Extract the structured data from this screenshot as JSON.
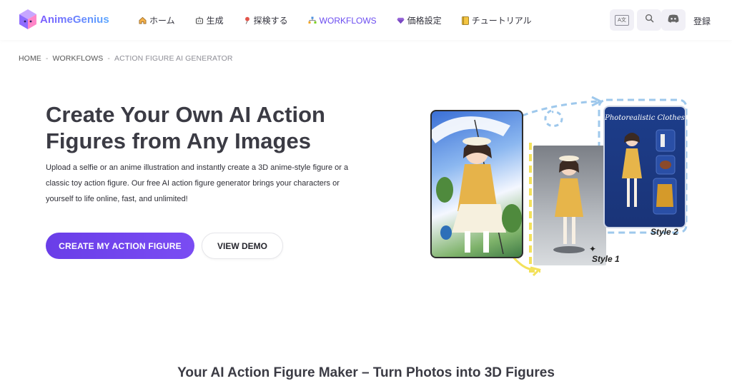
{
  "header": {
    "logo_text": "AnimeGenius",
    "nav": [
      {
        "label": "ホーム",
        "icon": "home-icon"
      },
      {
        "label": "生成",
        "icon": "robot-icon"
      },
      {
        "label": "探検する",
        "icon": "pin-icon"
      },
      {
        "label": "WORKFLOWS",
        "icon": "workflow-icon"
      },
      {
        "label": "価格設定",
        "icon": "gem-icon"
      },
      {
        "label": "チュートリアル",
        "icon": "book-icon"
      }
    ],
    "translate_icon_text": "A文",
    "register_label": "登録"
  },
  "breadcrumb": {
    "items": [
      "HOME",
      "WORKFLOWS",
      "ACTION FIGURE AI GENERATOR"
    ],
    "separator": "-"
  },
  "hero": {
    "title": "Create Your Own AI Action Figures from Any Images",
    "description": "Upload a selfie or an anime illustration and instantly create a 3D anime-style figure or a classic toy action figure. Our free AI action figure generator brings your characters or yourself to life online, fast, and unlimited!",
    "primary_button": "CREATE MY ACTION FIGURE",
    "secondary_button": "VIEW DEMO",
    "art": {
      "box_title": "Photorealistic Clothes",
      "style1_label": "Style 1",
      "style2_label": "Style 2"
    }
  },
  "section": {
    "heading": "Your AI Action Figure Maker – Turn Photos into 3D Figures"
  },
  "colors": {
    "accent": "#6b4cf0",
    "primary_button": "#6a3ee8",
    "dashed_frame": "#9ec8ec",
    "highlight_yellow": "#f3e15a"
  }
}
